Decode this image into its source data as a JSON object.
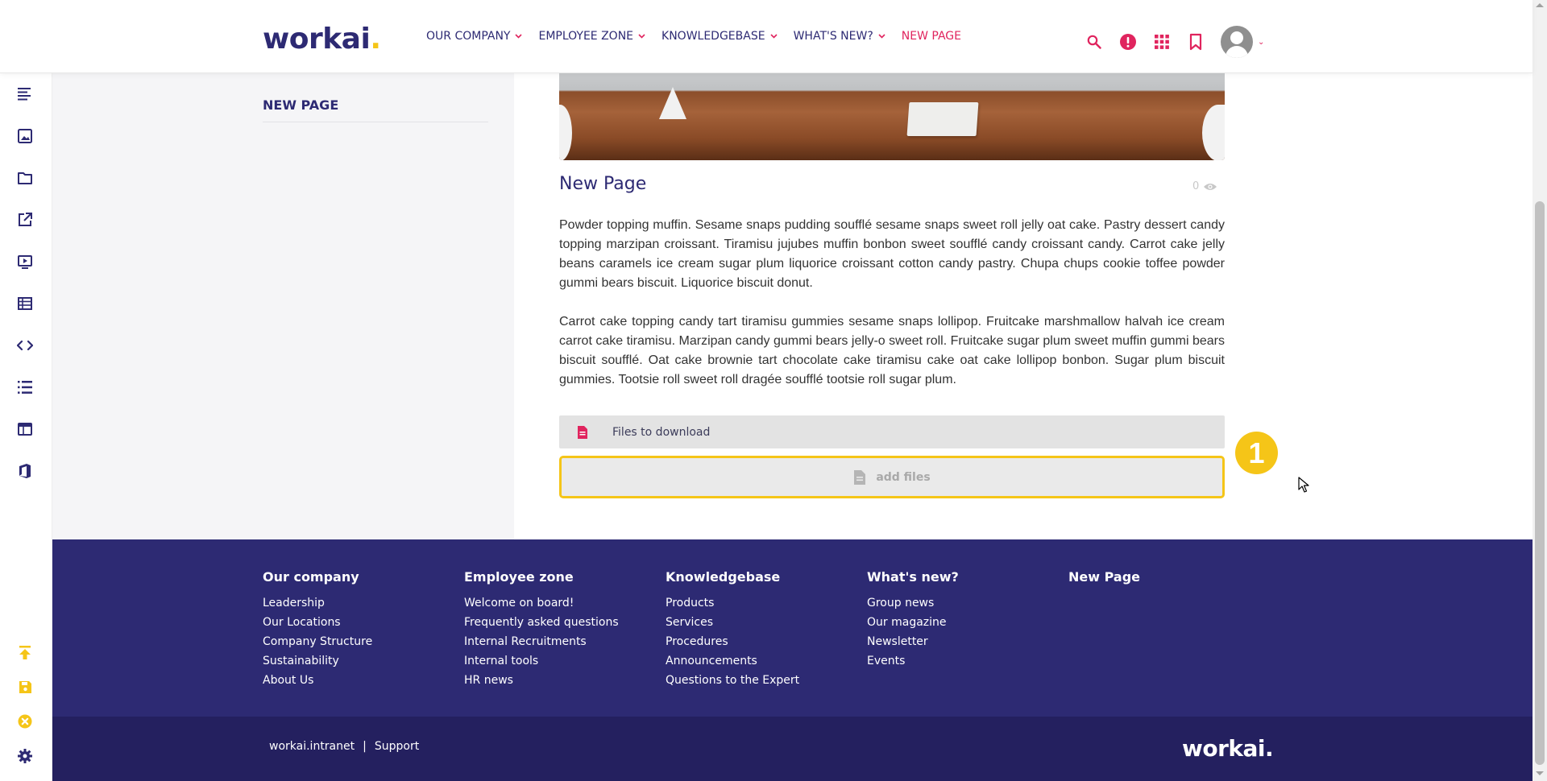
{
  "header": {
    "logo": "workai",
    "logo_dot": ".",
    "nav": [
      {
        "label": "OUR COMPANY",
        "dropdown": true
      },
      {
        "label": "EMPLOYEE ZONE",
        "dropdown": true
      },
      {
        "label": "KNOWLEDGEBASE",
        "dropdown": true
      },
      {
        "label": "WHAT'S NEW?",
        "dropdown": true
      },
      {
        "label": "NEW PAGE",
        "dropdown": false,
        "active": true
      }
    ],
    "icons": [
      "search-icon",
      "alert-icon",
      "apps-grid-icon",
      "bookmark-icon",
      "user-avatar"
    ]
  },
  "sidebar": {
    "title": "NEW PAGE",
    "tools": [
      "text-icon",
      "image-icon",
      "folder-icon",
      "external-link-icon",
      "video-icon",
      "table-icon",
      "code-icon",
      "list-icon",
      "layout-icon",
      "office-icon",
      "publish-icon",
      "save-icon",
      "close-icon",
      "settings-icon"
    ]
  },
  "article": {
    "title": "New Page",
    "views": "0",
    "paragraphs": [
      "Powder topping muffin. Sesame snaps pudding soufflé sesame snaps sweet roll jelly oat cake. Pastry dessert candy topping marzipan croissant. Tiramisu jujubes muffin bonbon sweet soufflé candy croissant candy. Carrot cake jelly beans caramels ice cream sugar plum liquorice croissant cotton candy pastry. Chupa chups cookie toffee powder gummi bears biscuit. Liquorice biscuit donut.",
      "Carrot cake topping candy tart tiramisu gummies sesame snaps lollipop. Fruitcake marshmallow halvah ice cream carrot cake tiramisu. Marzipan candy gummi bears jelly-o sweet roll. Fruitcake sugar plum sweet muffin gummi bears biscuit soufflé. Oat cake brownie tart chocolate cake tiramisu cake oat cake lollipop bonbon. Sugar plum biscuit gummies. Tootsie roll sweet roll dragée soufflé tootsie roll sugar plum."
    ],
    "files_label": "Files to download",
    "add_files_label": "add files",
    "step_badge": "1"
  },
  "footer": {
    "columns": [
      {
        "heading": "Our company",
        "links": [
          "Leadership",
          "Our Locations",
          "Company Structure",
          "Sustainability",
          "About Us"
        ]
      },
      {
        "heading": "Employee zone",
        "links": [
          "Welcome on board!",
          "Frequently asked questions",
          "Internal Recruitments",
          "Internal tools",
          "HR news"
        ]
      },
      {
        "heading": "Knowledgebase",
        "links": [
          "Products",
          "Services",
          "Procedures",
          "Announcements",
          "Questions to the Expert"
        ]
      },
      {
        "heading": "What's new?",
        "links": [
          "Group news",
          "Our magazine",
          "Newsletter",
          "Events"
        ]
      },
      {
        "heading": "New Page",
        "links": []
      }
    ],
    "bottom_links": [
      "workai.intranet",
      "|",
      "Support"
    ],
    "logo": "workai."
  },
  "colors": {
    "brand_navy": "#2d2a73",
    "accent_pink": "#e0245e",
    "highlight_yellow": "#f5c518"
  }
}
